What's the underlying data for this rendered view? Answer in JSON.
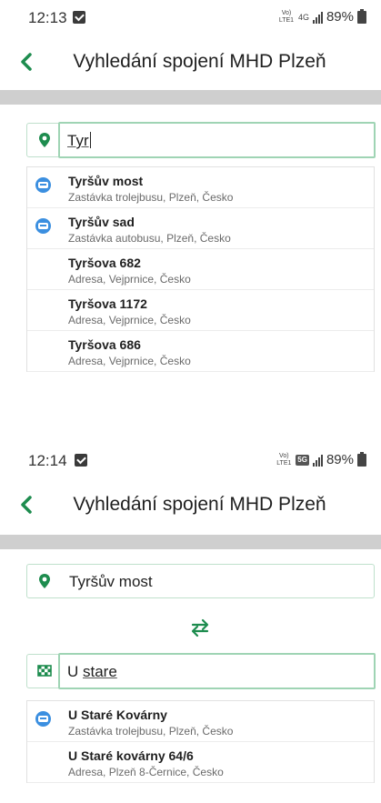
{
  "colors": {
    "accent": "#1d8c4e",
    "stop_icon": "#3b8fe0",
    "divider": "#cfcfcf",
    "field_border": "#9fd4b4"
  },
  "screen1": {
    "status": {
      "time": "12:13",
      "network_badge": "Vo) LTE1",
      "network_type": "4G",
      "battery": "89%"
    },
    "title": "Vyhledání spojení MHD Plzeň",
    "from_field": {
      "value": "Tyr",
      "icon": "location-pin-icon"
    },
    "suggestions": [
      {
        "title": "Tyršův most",
        "subtitle": "Zastávka trolejbusu, Plzeň, Česko",
        "icon": "bus-stop-icon"
      },
      {
        "title": "Tyršův sad",
        "subtitle": "Zastávka autobusu, Plzeň, Česko",
        "icon": "bus-stop-icon"
      },
      {
        "title": "Tyršova 682",
        "subtitle": "Adresa, Vejprnice, Česko",
        "icon": ""
      },
      {
        "title": "Tyršova 1172",
        "subtitle": "Adresa, Vejprnice, Česko",
        "icon": ""
      },
      {
        "title": "Tyršova 686",
        "subtitle": "Adresa, Vejprnice, Česko",
        "icon": ""
      }
    ]
  },
  "screen2": {
    "status": {
      "time": "12:14",
      "network_badge": "Vo) LTE1",
      "network_type": "5G",
      "battery": "89%"
    },
    "title": "Vyhledání spojení MHD Plzeň",
    "from_field": {
      "value": "Tyršův most",
      "icon": "location-pin-icon"
    },
    "to_field": {
      "value_prefix": "U ",
      "value_underlined": "stare",
      "icon": "finish-flag-icon"
    },
    "suggestions": [
      {
        "title": "U Staré Kovárny",
        "subtitle": "Zastávka trolejbusu, Plzeň, Česko",
        "icon": "bus-stop-icon"
      },
      {
        "title": "U Staré kovárny 64/6",
        "subtitle": "Adresa, Plzeň 8-Černice, Česko",
        "icon": ""
      }
    ]
  }
}
